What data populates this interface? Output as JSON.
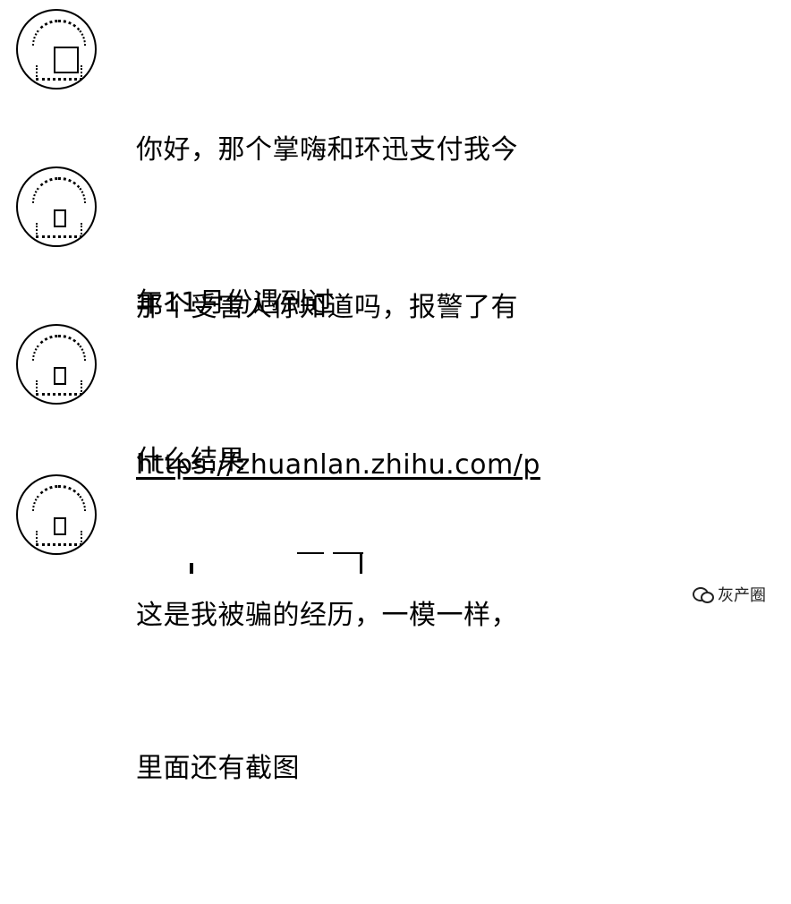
{
  "messages": [
    {
      "avatar_icon": "user-avatar-icon",
      "lines": [
        "你好，那个掌嗨和环迅支付我今",
        "年11月份遇到过"
      ]
    },
    {
      "avatar_icon": "user-avatar-icon",
      "lines": [
        "那个受害人你知道吗，报警了有",
        "什么结果"
      ]
    },
    {
      "avatar_icon": "user-avatar-icon",
      "link_text": "https://zhuanlan.zhihu.com/p"
    },
    {
      "avatar_icon": "user-avatar-icon",
      "lines": [
        "这是我被骗的经历，一模一样，",
        "里面还有截图"
      ]
    }
  ],
  "watermark": {
    "icon": "wechat-icon",
    "text": "灰产圈"
  }
}
